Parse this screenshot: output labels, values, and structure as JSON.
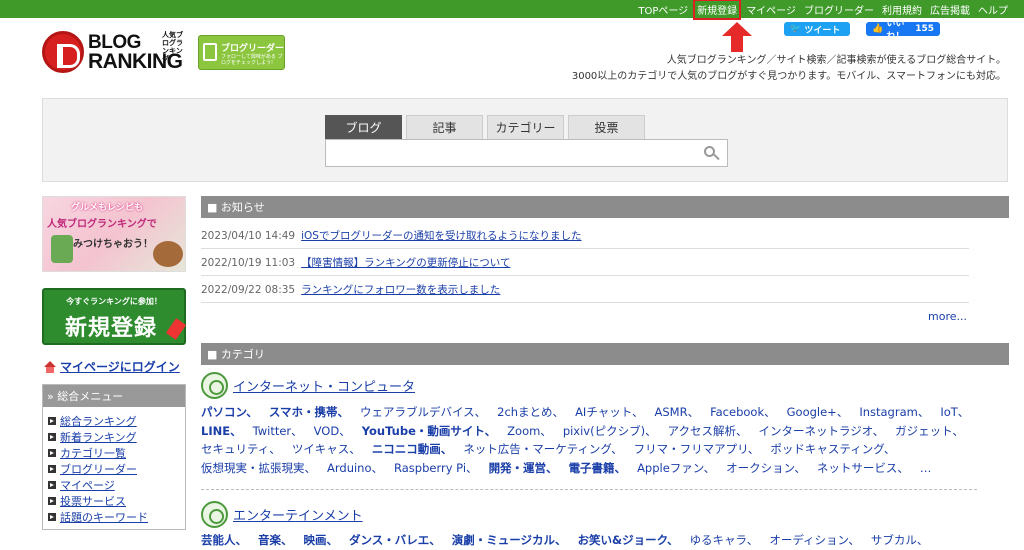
{
  "topnav": [
    "TOPページ",
    "新規登録",
    "マイページ",
    "ブログリーダー",
    "利用規約",
    "広告掲載",
    "ヘルプ"
  ],
  "social": {
    "tweet": "ツイート",
    "like": "いいね！",
    "like_count": "155"
  },
  "logo": {
    "line1": "BLOG",
    "line2": "RANKING",
    "sub": "人気ブログランキング"
  },
  "reader_badge": {
    "title": "ブログリーダー",
    "sub": "フォローして興味がある ブログをチェックしよう!"
  },
  "description": [
    "人気ブログランキング／サイト検索／記事検索が使えるブログ総合サイト。",
    "3000以上のカテゴリで人気のブログがすぐ見つかります。モバイル、スマートフォンにも対応。"
  ],
  "search": {
    "tabs": [
      "ブログ",
      "記事",
      "カテゴリー",
      "投票"
    ],
    "active_tab": "ブログ",
    "value": "",
    "placeholder": ""
  },
  "banner": {
    "line1": "グルメもレシピも",
    "line2": "人気ブログランキングで",
    "line3": "みつけちゃおう！"
  },
  "register": {
    "sub": "今すぐランキングに参加！",
    "main": "新規登録"
  },
  "login_link": "マイページにログイン",
  "menu": {
    "title": "総合メニュー",
    "items": [
      "総合ランキング",
      "新着ランキング",
      "カテゴリ一覧",
      "ブログリーダー",
      "マイページ",
      "投票サービス",
      "話題のキーワード"
    ]
  },
  "news": {
    "title": "お知らせ",
    "items": [
      {
        "date": "2023/04/10 14:49",
        "text": "iOSでブログリーダーの通知を受け取れるようになりました"
      },
      {
        "date": "2022/10/19 11:03",
        "text": "【障害情報】ランキングの更新停止について"
      },
      {
        "date": "2022/09/22 08:35",
        "text": "ランキングにフォロワー数を表示しました"
      }
    ],
    "more": "more..."
  },
  "categories": {
    "title": "カテゴリ",
    "groups": [
      {
        "name": "インターネット・コンピュータ",
        "keywords": [
          {
            "t": "パソコン",
            "b": true
          },
          {
            "t": "スマホ・携帯",
            "b": true
          },
          {
            "t": "ウェアラブルデバイス",
            "b": false
          },
          {
            "t": "2chまとめ",
            "b": false
          },
          {
            "t": "AIチャット",
            "b": false
          },
          {
            "t": "ASMR",
            "b": false
          },
          {
            "t": "Facebook",
            "b": false
          },
          {
            "t": "Google+",
            "b": false
          },
          {
            "t": "Instagram",
            "b": false
          },
          {
            "t": "IoT",
            "b": false
          },
          {
            "t": "LINE",
            "b": true
          },
          {
            "t": "Twitter",
            "b": false
          },
          {
            "t": "VOD",
            "b": false
          },
          {
            "t": "YouTube・動画サイト",
            "b": true
          },
          {
            "t": "Zoom",
            "b": false
          },
          {
            "t": "pixiv(ピクシブ)",
            "b": false
          },
          {
            "t": "アクセス解析",
            "b": false
          },
          {
            "t": "インターネットラジオ",
            "b": false
          },
          {
            "t": "ガジェット",
            "b": false
          },
          {
            "t": "セキュリティ",
            "b": false
          },
          {
            "t": "ツイキャス",
            "b": false
          },
          {
            "t": "ニコニコ動画",
            "b": true
          },
          {
            "t": "ネット広告・マーケティング",
            "b": false
          },
          {
            "t": "フリマ・フリマアプリ",
            "b": false
          },
          {
            "t": "ポッドキャスティング",
            "b": false
          },
          {
            "t": "仮想現実・拡張現実",
            "b": false
          },
          {
            "t": "Arduino",
            "b": false
          },
          {
            "t": "Raspberry Pi",
            "b": false
          },
          {
            "t": "開発・運営",
            "b": true
          },
          {
            "t": "電子書籍",
            "b": true
          },
          {
            "t": "Appleファン",
            "b": false
          },
          {
            "t": "オークション",
            "b": false
          },
          {
            "t": "ネットサービス",
            "b": false
          },
          {
            "t": "…",
            "b": false
          }
        ]
      },
      {
        "name": "エンターテインメント",
        "keywords": [
          {
            "t": "芸能人",
            "b": true
          },
          {
            "t": "音楽",
            "b": true
          },
          {
            "t": "映画",
            "b": true
          },
          {
            "t": "ダンス・バレエ",
            "b": true
          },
          {
            "t": "演劇・ミュージカル",
            "b": true
          },
          {
            "t": "お笑い&ジョーク",
            "b": true
          },
          {
            "t": "ゆるキャラ",
            "b": false
          },
          {
            "t": "オーディション",
            "b": false
          },
          {
            "t": "サブカル",
            "b": false
          }
        ]
      }
    ]
  }
}
